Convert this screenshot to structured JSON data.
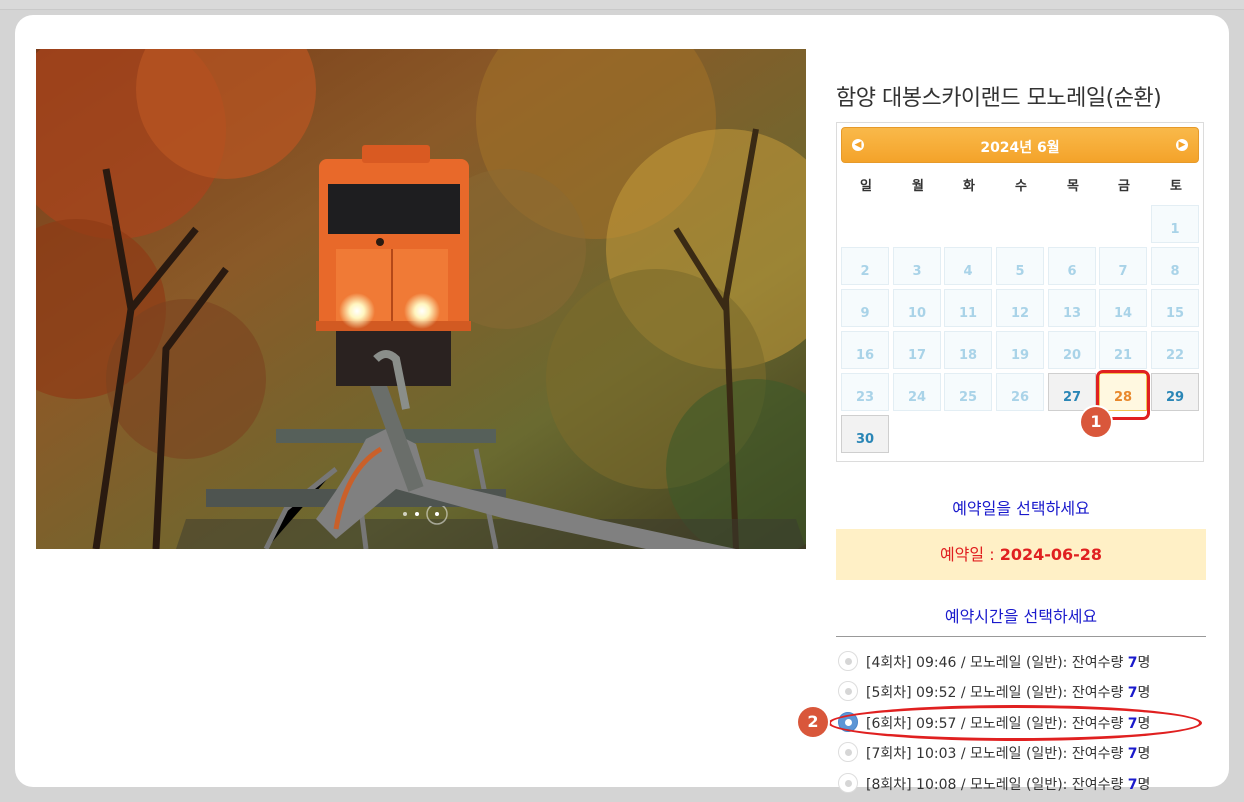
{
  "product_title": "함양 대봉스카이랜드 모노레일(순환)",
  "calendar": {
    "month_label": "2024년 6월",
    "prev_icon": "◀",
    "next_icon": "▶",
    "weekdays": [
      "일",
      "월",
      "화",
      "수",
      "목",
      "금",
      "토"
    ],
    "days": [
      "1",
      "2",
      "3",
      "4",
      "5",
      "6",
      "7",
      "8",
      "9",
      "10",
      "11",
      "12",
      "13",
      "14",
      "15",
      "16",
      "17",
      "18",
      "19",
      "20",
      "21",
      "22",
      "23",
      "24",
      "25",
      "26",
      "27",
      "28",
      "29",
      "30"
    ],
    "available_days": [
      "27",
      "28",
      "29",
      "30"
    ],
    "selected_day": "28"
  },
  "annotations": {
    "badge1": "1",
    "badge2": "2"
  },
  "date_prompt": "예약일을 선택하세요",
  "selected_date": {
    "label": "예약일 : ",
    "value": "2024-06-28"
  },
  "time_prompt": "예약시간을 선택하세요",
  "time_slots": [
    {
      "text": "[4회차] 09:46  / 모노레일 (일반): 잔여수량 ",
      "qty": "7",
      "unit": "명",
      "selected": false
    },
    {
      "text": "[5회차] 09:52  / 모노레일 (일반): 잔여수량 ",
      "qty": "7",
      "unit": "명",
      "selected": false
    },
    {
      "text": "[6회차] 09:57  / 모노레일 (일반): 잔여수량 ",
      "qty": "7",
      "unit": "명",
      "selected": true
    },
    {
      "text": "[7회차] 10:03  / 모노레일 (일반): 잔여수량 ",
      "qty": "7",
      "unit": "명",
      "selected": false
    },
    {
      "text": "[8회차] 10:08  / 모노레일 (일반): 잔여수량 ",
      "qty": "7",
      "unit": "명",
      "selected": false
    }
  ],
  "colors": {
    "accent": "#f4a32a",
    "prompt_blue": "#1a1acc",
    "date_red": "#e02020",
    "highlight_red": "#e02020"
  }
}
